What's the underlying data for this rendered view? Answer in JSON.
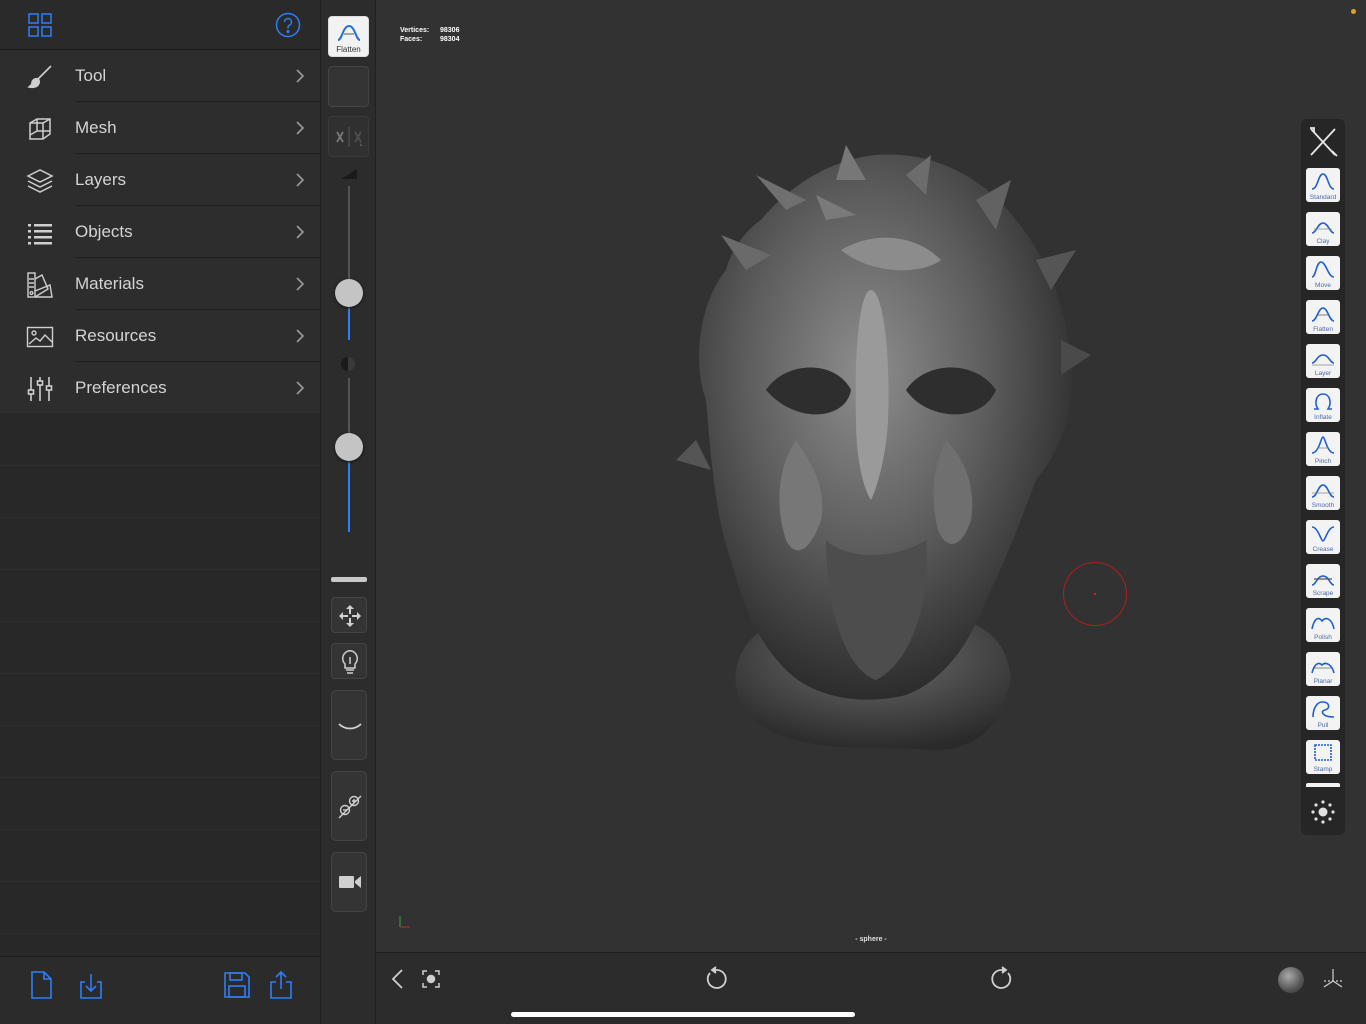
{
  "left_panel": {
    "menu": [
      {
        "key": "tool",
        "label": "Tool"
      },
      {
        "key": "mesh",
        "label": "Mesh"
      },
      {
        "key": "layers",
        "label": "Layers"
      },
      {
        "key": "objects",
        "label": "Objects"
      },
      {
        "key": "materials",
        "label": "Materials"
      },
      {
        "key": "resources",
        "label": "Resources"
      },
      {
        "key": "preferences",
        "label": "Preferences"
      }
    ]
  },
  "toolbar": {
    "current_tool_label": "Flatten",
    "radius_slider": 0.2,
    "intensity_slider": 0.45
  },
  "viewport": {
    "stats": {
      "vertices_label": "Vertices:",
      "vertices_value": "98306",
      "faces_label": "Faces:",
      "faces_value": "98304"
    },
    "object_name": "- sphere -"
  },
  "brushes": [
    "Standard",
    "Clay",
    "Move",
    "Flatten",
    "Layer",
    "Inflate",
    "Pinch",
    "Smooth",
    "Crease",
    "Scrape",
    "Polish",
    "Planar",
    "Pull",
    "Stamp"
  ],
  "colors": {
    "accent": "#2d7ff9",
    "panel": "#2d2d2d",
    "viewport": "#323232",
    "cursor": "#b01e1e"
  }
}
